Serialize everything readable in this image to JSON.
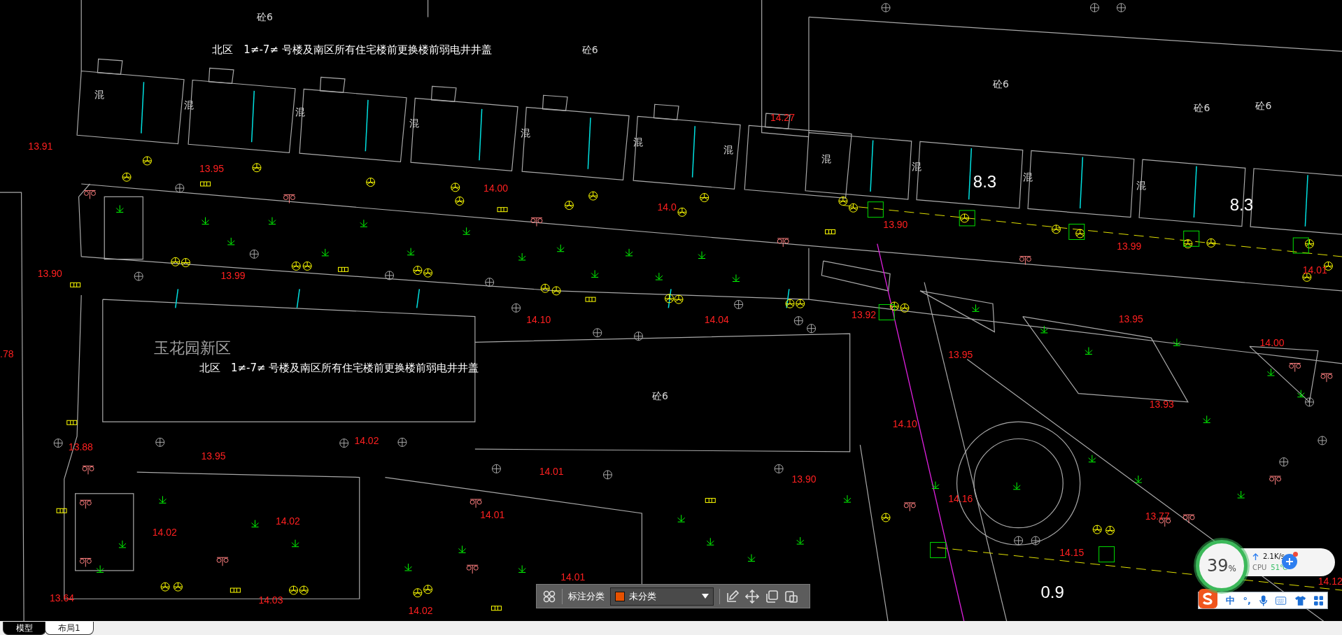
{
  "canvas": {
    "labels": [
      {
        "kind": "building",
        "text": "砼6"
      },
      {
        "kind": "title",
        "text": "北区　1≠-7≠ 号楼及南区所有住宅楼前更换楼前弱电井井盖"
      },
      {
        "kind": "building",
        "text": "砼6"
      },
      {
        "kind": "building",
        "text": "砼6"
      },
      {
        "kind": "building",
        "text": "砼6"
      },
      {
        "kind": "building",
        "text": "砼6"
      },
      {
        "kind": "building",
        "text": "混"
      },
      {
        "kind": "building",
        "text": "混"
      },
      {
        "kind": "building",
        "text": "混"
      },
      {
        "kind": "building",
        "text": "混"
      },
      {
        "kind": "building",
        "text": "混"
      },
      {
        "kind": "building",
        "text": "混"
      },
      {
        "kind": "building",
        "text": "混"
      },
      {
        "kind": "building",
        "text": "混"
      },
      {
        "kind": "building",
        "text": "混"
      },
      {
        "kind": "dimension",
        "text": "8.3"
      },
      {
        "kind": "building",
        "text": "混"
      },
      {
        "kind": "building",
        "text": "混"
      },
      {
        "kind": "dimension",
        "text": "8.3"
      },
      {
        "kind": "elevation",
        "text": "13.91"
      },
      {
        "kind": "elevation",
        "text": "13.95"
      },
      {
        "kind": "elevation",
        "text": "14.00"
      },
      {
        "kind": "elevation",
        "text": "14.0"
      },
      {
        "kind": "elevation",
        "text": "14.27"
      },
      {
        "kind": "elevation",
        "text": "13.90"
      },
      {
        "kind": "elevation",
        "text": "13.99"
      },
      {
        "kind": "elevation",
        "text": "14.01"
      },
      {
        "kind": "elevation",
        "text": "13.90"
      },
      {
        "kind": "elevation",
        "text": "13.99"
      },
      {
        "kind": "elevation",
        "text": "14.10"
      },
      {
        "kind": "elevation",
        "text": "14.04"
      },
      {
        "kind": "elevation",
        "text": "13.92"
      },
      {
        "kind": "elevation",
        "text": "13.95"
      },
      {
        "kind": "elevation",
        "text": "13.95"
      },
      {
        "kind": "elevation",
        "text": "14.00"
      },
      {
        "kind": "elevation",
        "text": "13.93"
      },
      {
        "kind": "elevation",
        "text": "14.10"
      },
      {
        "kind": "elevation",
        "text": "13.88"
      },
      {
        "kind": "elevation",
        "text": "13.95"
      },
      {
        "kind": "elevation",
        "text": "14.02"
      },
      {
        "kind": "elevation",
        "text": "14.01"
      },
      {
        "kind": "elevation",
        "text": "13.90"
      },
      {
        "kind": "elevation",
        "text": "14.16"
      },
      {
        "kind": "elevation",
        "text": "14.02"
      },
      {
        "kind": "elevation",
        "text": "14.02"
      },
      {
        "kind": "elevation",
        "text": "14.01"
      },
      {
        "kind": "elevation",
        "text": "13.77"
      },
      {
        "kind": "elevation",
        "text": "14.15"
      },
      {
        "kind": "elevation",
        "text": "14.12"
      },
      {
        "kind": "elevation",
        "text": "14.01"
      },
      {
        "kind": "elevation",
        "text": "13.64"
      },
      {
        "kind": "elevation",
        "text": "14.03"
      },
      {
        "kind": "elevation",
        "text": "14.02"
      },
      {
        "kind": "elevation",
        "text": ".78"
      },
      {
        "kind": "area",
        "text": "玉花园新区"
      },
      {
        "kind": "title",
        "text": "北区　1≠-7≠ 号楼及南区所有住宅楼前更换楼前弱电井井盖"
      },
      {
        "kind": "building",
        "text": "砼6"
      },
      {
        "kind": "dimension",
        "text": "0.9"
      }
    ]
  },
  "annotation_toolbar": {
    "label": "标注分类",
    "category": "未分类"
  },
  "tabs": [
    {
      "label": "模型",
      "selected": true
    },
    {
      "label": "布局1",
      "selected": false
    }
  ],
  "monitor": {
    "percent": "39",
    "unit": "%",
    "speed": "2.1K/s",
    "cpu_label": "CPU",
    "cpu_temp": "51℃"
  },
  "ime": {
    "mode": "中",
    "punct": "°,"
  }
}
